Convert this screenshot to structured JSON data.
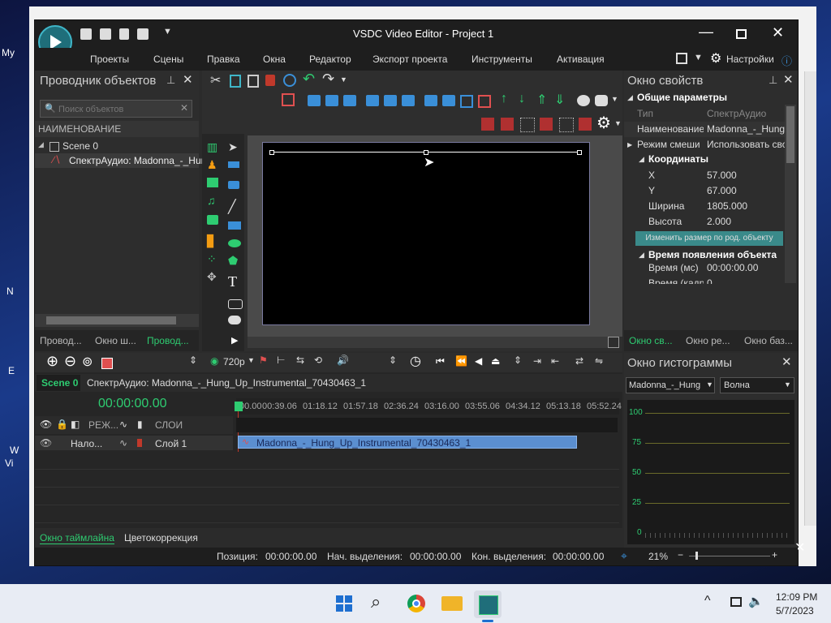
{
  "desktop": {
    "labels": [
      "My",
      "N",
      "E",
      "W",
      "Vi"
    ]
  },
  "app": {
    "title": "VSDC Video Editor - Project 1",
    "menu": [
      "Проекты",
      "Сцены",
      "Правка",
      "Окна",
      "Редактор",
      "Экспорт проекта",
      "Инструменты",
      "Активация"
    ],
    "settings_label": "Настройки"
  },
  "explorer": {
    "title": "Проводник объектов",
    "search_placeholder": "Поиск объектов",
    "header": "НАИМЕНОВАНИЕ",
    "tree": [
      "Scene 0",
      "СпектрАудио: Madonna_-_Hun"
    ],
    "tabs": [
      "Провод...",
      "Окно ш...",
      "Провод..."
    ]
  },
  "properties": {
    "title": "Окно свойств",
    "section_general": "Общие параметры",
    "rows": [
      {
        "name": "Тип",
        "value": "СпектрАудио"
      },
      {
        "name": "Наименование",
        "value": "Madonna_-_Hung"
      },
      {
        "name": "Режим смеши",
        "value": "Использовать сво"
      }
    ],
    "section_coords": "Координаты",
    "coords": [
      {
        "name": "X",
        "value": "57.000"
      },
      {
        "name": "Y",
        "value": "67.000"
      },
      {
        "name": "Ширина",
        "value": "1805.000"
      },
      {
        "name": "Высота",
        "value": "2.000"
      }
    ],
    "resize_button": "Изменить размер по род. объекту",
    "section_time": "Время появления объекта",
    "time_rows": [
      {
        "name": "Время (мс)",
        "value": "00:00:00.00"
      },
      {
        "name": "Время (кадр",
        "value": "0"
      }
    ],
    "tabs": [
      "Окно св...",
      "Окно ре...",
      "Окно баз..."
    ]
  },
  "timeline": {
    "resolution": "720p",
    "tabs": [
      "Scene 0",
      "СпектрАудио: Madonna_-_Hung_Up_Instrumental_70430463_1"
    ],
    "time": "00:00:00.00",
    "ruler": [
      "00.00",
      "00:39.06",
      "01:18.12",
      "01:57.18",
      "02:36.24",
      "03:16.00",
      "03:55.06",
      "04:34.12",
      "05:13.18",
      "05:52.24"
    ],
    "header_mode": "РЕЖ...",
    "header_layers": "СЛОИ",
    "track_mode": "Нало...",
    "track_name": "Слой 1",
    "clip_name": "Madonna_-_Hung_Up_Instrumental_70430463_1"
  },
  "histogram": {
    "title": "Окно гистограммы",
    "source": "Madonna_-_Hung",
    "mode": "Волна",
    "ticks": [
      "100",
      "75",
      "50",
      "25",
      "0"
    ]
  },
  "bottom": {
    "tabs": [
      "Окно таймлайна",
      "Цветокоррекция"
    ],
    "position_label": "Позиция:",
    "position_value": "00:00:00.00",
    "sel_start_label": "Нач. выделения:",
    "sel_start_value": "00:00:00.00",
    "sel_end_label": "Кон. выделения:",
    "sel_end_value": "00:00:00.00",
    "zoom": "21%"
  },
  "taskbar": {
    "time": "12:09 PM",
    "date": "5/7/2023"
  }
}
